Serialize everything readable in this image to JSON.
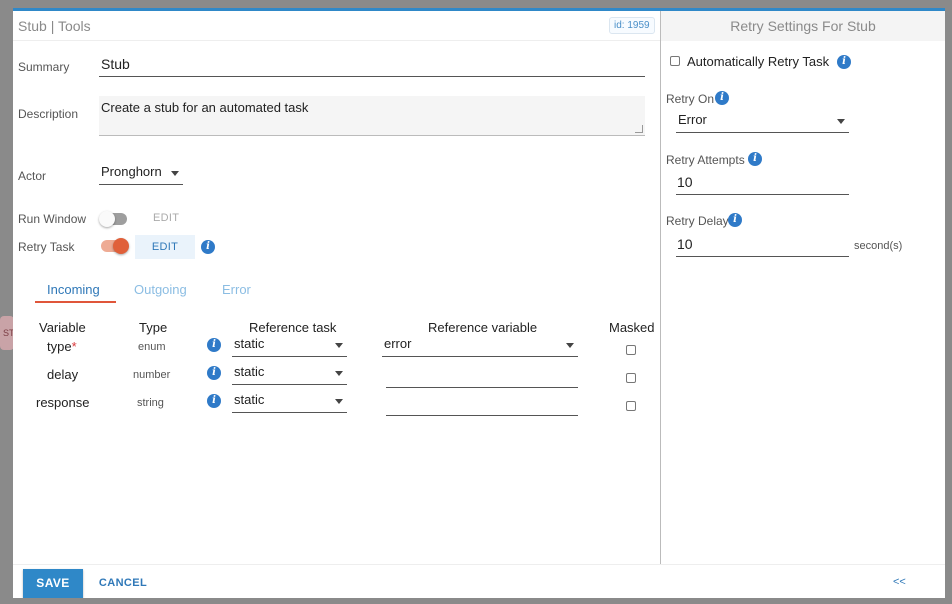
{
  "background_tab": {
    "label": "ST"
  },
  "left_panel": {
    "title": "Stub | Tools",
    "id_badge": "id: 1959",
    "summary": {
      "label": "Summary",
      "value": "Stub"
    },
    "description": {
      "label": "Description",
      "value": "Create a stub for an automated task"
    },
    "actor": {
      "label": "Actor",
      "value": "Pronghorn"
    },
    "run_window": {
      "label": "Run Window",
      "enabled": false,
      "edit_label": "EDIT"
    },
    "retry_task": {
      "label": "Retry Task",
      "enabled": true,
      "edit_label": "EDIT"
    },
    "tabs": [
      {
        "label": "Incoming",
        "active": true
      },
      {
        "label": "Outgoing",
        "active": false
      },
      {
        "label": "Error",
        "active": false
      }
    ],
    "table": {
      "headers": {
        "variable": "Variable",
        "type": "Type",
        "reference_task": "Reference task",
        "reference_variable": "Reference variable",
        "masked": "Masked"
      },
      "rows": [
        {
          "variable": "type",
          "required_mark": "*",
          "type": "enum",
          "reference_task": "static",
          "reference_variable": "error",
          "masked": false
        },
        {
          "variable": "delay",
          "required_mark": "",
          "type": "number",
          "reference_task": "static",
          "reference_variable": "",
          "masked": false
        },
        {
          "variable": "response",
          "required_mark": "",
          "type": "string",
          "reference_task": "static",
          "reference_variable": "",
          "masked": false
        }
      ]
    }
  },
  "right_panel": {
    "title": "Retry Settings For Stub",
    "auto_retry": {
      "label": "Automatically Retry Task",
      "checked": false
    },
    "retry_on": {
      "label": "Retry On",
      "value": "Error"
    },
    "retry_attempts": {
      "label": "Retry Attempts",
      "value": "10"
    },
    "retry_delay": {
      "label": "Retry Delay",
      "value": "10",
      "unit": "second(s)"
    }
  },
  "footer": {
    "save_label": "SAVE",
    "cancel_label": "CANCEL",
    "collapse_label": "<<"
  },
  "colors": {
    "accent": "#2f88c8",
    "toggle_on": "#e0603a",
    "tab_underline": "#e0563a",
    "info": "#2f7ac8"
  },
  "icons": {
    "info": "info-icon",
    "caret": "caret-down-icon"
  }
}
